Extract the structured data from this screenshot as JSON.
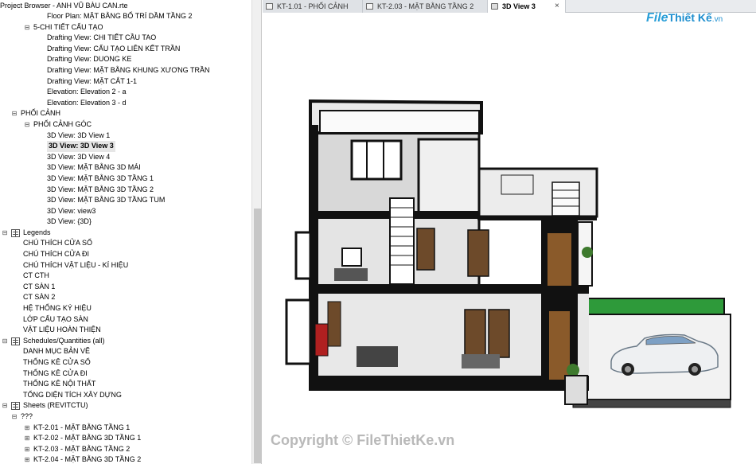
{
  "browser": {
    "title": "Project Browser - ANH VŨ BÀU CAN.rte",
    "tree": [
      {
        "label": "Floor Plan: MẶT BẰNG BỐ TRÍ DẦM TẦNG 2",
        "level": 4
      },
      {
        "label": "5-CHI TIẾT CẤU TẠO",
        "level": 2,
        "twist": "−"
      },
      {
        "label": "Drafting View: CHI TIẾT CẦU TAO",
        "level": 4
      },
      {
        "label": "Drafting View: CẤU TẠO LIÊN KẾT TRẦN",
        "level": 4
      },
      {
        "label": "Drafting View: DUONG KE",
        "level": 4
      },
      {
        "label": "Drafting View: MẶT BẰNG KHUNG XƯƠNG TRẦN",
        "level": 4
      },
      {
        "label": "Drafting View: MẶT CẮT 1-1",
        "level": 4
      },
      {
        "label": "Elevation: Elevation 2 - a",
        "level": 4
      },
      {
        "label": "Elevation: Elevation 3 - d",
        "level": 4
      },
      {
        "label": "PHỐI CẢNH",
        "level": 1,
        "twist": "−"
      },
      {
        "label": "PHỐI CẢNH GÓC",
        "level": 2,
        "twist": "−"
      },
      {
        "label": "3D View: 3D View 1",
        "level": 4
      },
      {
        "label": "3D View: 3D View 3",
        "level": 4,
        "selected": true
      },
      {
        "label": "3D View: 3D View 4",
        "level": 4
      },
      {
        "label": "3D View: MẶT BẰNG 3D MÁI",
        "level": 4
      },
      {
        "label": "3D View: MẶT BẰNG 3D TẦNG 1",
        "level": 4
      },
      {
        "label": "3D View: MẶT BẰNG 3D TẦNG 2",
        "level": 4
      },
      {
        "label": "3D View: MẶT BẰNG 3D TẦNG TUM",
        "level": 4
      },
      {
        "label": "3D View: view3",
        "level": 4
      },
      {
        "label": "3D View: {3D}",
        "level": 4
      },
      {
        "label": "Legends",
        "level": 0,
        "twist": "−",
        "icon": true
      },
      {
        "label": "CHÚ THÍCH CỬA SỔ",
        "level": 3
      },
      {
        "label": "CHÚ THÍCH CỬA ĐI",
        "level": 3
      },
      {
        "label": "CHÚ THÍCH VẬT LIỆU - KÍ HIỆU",
        "level": 3
      },
      {
        "label": "CT CTH",
        "level": 3
      },
      {
        "label": "CT SÀN 1",
        "level": 3
      },
      {
        "label": "CT SÀN 2",
        "level": 3
      },
      {
        "label": "HỆ THỐNG KÝ HIỆU",
        "level": 3
      },
      {
        "label": "LỚP CẤU TẠO SÀN",
        "level": 3
      },
      {
        "label": "VẬT LIỆU HOÀN THIỆN",
        "level": 3
      },
      {
        "label": "Schedules/Quantities (all)",
        "level": 0,
        "twist": "−",
        "icon": true
      },
      {
        "label": "DANH MỤC BẢN VẼ",
        "level": 3
      },
      {
        "label": "THỐNG KÊ CỬA SỔ",
        "level": 3
      },
      {
        "label": "THỐNG KÊ CỬA ĐI",
        "level": 3
      },
      {
        "label": "THỐNG KÊ NỘI THẤT",
        "level": 3
      },
      {
        "label": "TỔNG DIỆN TÍCH XÂY DỰNG",
        "level": 3
      },
      {
        "label": "Sheets (REVITCTU)",
        "level": 0,
        "twist": "−",
        "icon": true
      },
      {
        "label": "???",
        "level": 1,
        "twist": "−"
      },
      {
        "label": "KT-2.01 - MẶT  BẰNG TẦNG 1",
        "level": 2,
        "twist": "+"
      },
      {
        "label": "KT-2.02 - MẶT BẰNG 3D TẦNG 1",
        "level": 2,
        "twist": "+"
      },
      {
        "label": "KT-2.03 - MẶT BẰNG TẦNG 2",
        "level": 2,
        "twist": "+"
      },
      {
        "label": "KT-2.04 - MẶT BẰNG 3D TẦNG 2",
        "level": 2,
        "twist": "+"
      }
    ]
  },
  "tabs": [
    {
      "label": "KT-1.01 - PHỐI CẢNH",
      "active": false
    },
    {
      "label": "KT-2.03 - MẶT BẰNG TẦNG 2",
      "active": false
    },
    {
      "label": "3D View 3",
      "active": true
    }
  ],
  "tab_close": "×",
  "logo": {
    "part1": "File",
    "part2": "Thiết Kế",
    "part3": ".vn"
  },
  "copyright": "Copyright © FileThietKe.vn",
  "colors": {
    "accent": "#2a9fd8",
    "grass": "#2e9a3a",
    "wood": "#8a5a2a",
    "wall": "#111111"
  }
}
